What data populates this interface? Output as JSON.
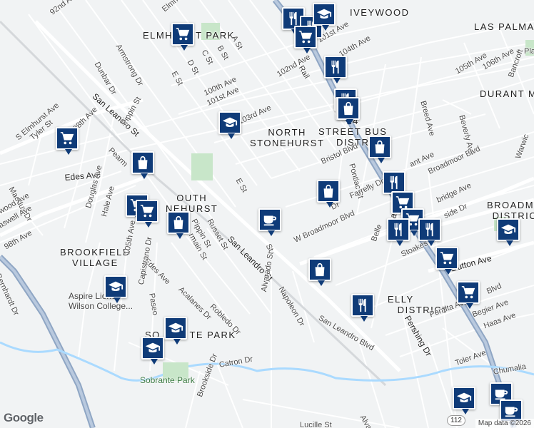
{
  "map": {
    "areas": [
      {
        "text": "IVEYWOOD"
      },
      {
        "text": "LAS PALMA"
      },
      {
        "text": "ELMHURST PARK"
      },
      {
        "text": "DURANT MANOR"
      },
      {
        "text": "NORTH\nSTONEHURST"
      },
      {
        "text": "14\nSTREET BUS\nDISTR"
      },
      {
        "text": "OUTH\nNEHURST"
      },
      {
        "text": "BROADMO\nDISTRIC"
      },
      {
        "text": "BROOKFIELD\nVILLAGE"
      },
      {
        "text": "ELLY\nPO        DISTRICT"
      },
      {
        "text": "SO        TE PARK"
      }
    ],
    "streets": [
      {
        "text": "92nd Ave"
      },
      {
        "text": "Elmhurst Ave"
      },
      {
        "text": "Dunbar Dr"
      },
      {
        "text": "Armstrong Dr"
      },
      {
        "text": "San Leandro St"
      },
      {
        "text": "98th Ave"
      },
      {
        "text": "Pippin St"
      },
      {
        "text": "Pearm"
      },
      {
        "text": "S Elmhurst Ave"
      },
      {
        "text": "Tyler St"
      },
      {
        "text": "Edes Ave"
      },
      {
        "text": "Maddux Dr"
      },
      {
        "text": "wood Ave"
      },
      {
        "text": "aswell Ave"
      },
      {
        "text": "98th Ave"
      },
      {
        "text": "Douglas Ave"
      },
      {
        "text": "Hale Ave"
      },
      {
        "text": "E St"
      },
      {
        "text": "D St"
      },
      {
        "text": "C St"
      },
      {
        "text": "B St"
      },
      {
        "text": "A St"
      },
      {
        "text": "100th Ave"
      },
      {
        "text": "101st Ave"
      },
      {
        "text": "103rd Ave"
      },
      {
        "text": "102nd Ave"
      },
      {
        "text": "101st Ave"
      },
      {
        "text": "104th Ave"
      },
      {
        "text": "105th Ave"
      },
      {
        "text": "106th Ave"
      },
      {
        "text": "Bancroft"
      },
      {
        "text": "Breed Ave"
      },
      {
        "text": "Beverly Ave"
      },
      {
        "text": "Warwic"
      },
      {
        "text": "Bristol Blvd"
      },
      {
        "text": "Pontiac St"
      },
      {
        "text": "ant Ave"
      },
      {
        "text": "Broadmoor Blvd"
      },
      {
        "text": "E St"
      },
      {
        "text": "Farrelly Dr"
      },
      {
        "text": "Dr"
      },
      {
        "text": "Russet St"
      },
      {
        "text": "Pippin St"
      },
      {
        "text": "rmain St"
      },
      {
        "text": "San Leandro St"
      },
      {
        "text": "W Broadmoor Blvd"
      },
      {
        "text": "Garcia"
      },
      {
        "text": "bridge Ave"
      },
      {
        "text": "side Dr"
      },
      {
        "text": "Belle"
      },
      {
        "text": "Stoakes Ave"
      },
      {
        "text": "Dutton Ave"
      },
      {
        "text": "Blvd"
      },
      {
        "text": "105th Ave"
      },
      {
        "text": "Edes Ave"
      },
      {
        "text": "Capistrano Dr"
      },
      {
        "text": "Paseo"
      },
      {
        "text": "Acalanes Dr"
      },
      {
        "text": "Robledo Dr"
      },
      {
        "text": "Alvarado St"
      },
      {
        "text": "Napoleon Dr"
      },
      {
        "text": "San Leandro Blvd"
      },
      {
        "text": "Pershing Dr"
      },
      {
        "text": "Peralta Ave"
      },
      {
        "text": "Begier Ave"
      },
      {
        "text": "Haas Ave"
      },
      {
        "text": "Toler Ave"
      },
      {
        "text": "Chumalia"
      },
      {
        "text": "Bernhardt Dr"
      },
      {
        "text": "Catron Dr"
      },
      {
        "text": "Brookside Dr"
      },
      {
        "text": "Lucille St"
      },
      {
        "text": "Alvara"
      },
      {
        "text": "St"
      },
      {
        "text": "Rail"
      },
      {
        "text": "Pla"
      }
    ],
    "pois": [
      {
        "text": "Aspire Lione\nWilson College..."
      },
      {
        "text": "Sobrante Park"
      }
    ],
    "markers": [
      {
        "icon": "restaurant-icon"
      },
      {
        "icon": "restaurant-icon"
      },
      {
        "icon": "school-icon"
      },
      {
        "icon": "shopping-cart-icon"
      },
      {
        "icon": "shopping-cart-icon"
      },
      {
        "icon": "shopping-cart-icon"
      },
      {
        "icon": "restaurant-icon"
      },
      {
        "icon": "shopping-bag-icon"
      },
      {
        "icon": "restaurant-icon"
      },
      {
        "icon": "school-icon"
      },
      {
        "icon": "shopping-cart-icon"
      },
      {
        "icon": "shopping-bag-icon"
      },
      {
        "icon": "shopping-bag-icon"
      },
      {
        "icon": "restaurant-icon"
      },
      {
        "icon": "shopping-cart-icon"
      },
      {
        "icon": "shopping-cart-icon"
      },
      {
        "icon": "restaurant-icon"
      },
      {
        "icon": "restaurant-icon"
      },
      {
        "icon": "school-icon"
      },
      {
        "icon": "shopping-cart-icon"
      },
      {
        "icon": "shopping-cart-icon"
      },
      {
        "icon": "shopping-bag-icon"
      },
      {
        "icon": "coffee-icon"
      },
      {
        "icon": "shopping-bag-icon"
      },
      {
        "icon": "restaurant-icon"
      },
      {
        "icon": "school-icon"
      },
      {
        "icon": "school-icon"
      },
      {
        "icon": "school-icon"
      },
      {
        "icon": "coffee-icon"
      },
      {
        "icon": "coffee-icon"
      },
      {
        "icon": "school-icon"
      },
      {
        "icon": "shopping-cart-icon"
      },
      {
        "icon": "shopping-cart-icon"
      },
      {
        "icon": "shopping-bag-icon"
      }
    ],
    "route_badge": "112",
    "google_logo": "Google",
    "attribution": "Map data ©2026"
  },
  "colors": {
    "background": "#f1f3f4",
    "road": "#ffffff",
    "highway": "#8fa6c4",
    "water": "#aadaff",
    "park": "#c8e6c9",
    "marker": "#0f3b78"
  }
}
